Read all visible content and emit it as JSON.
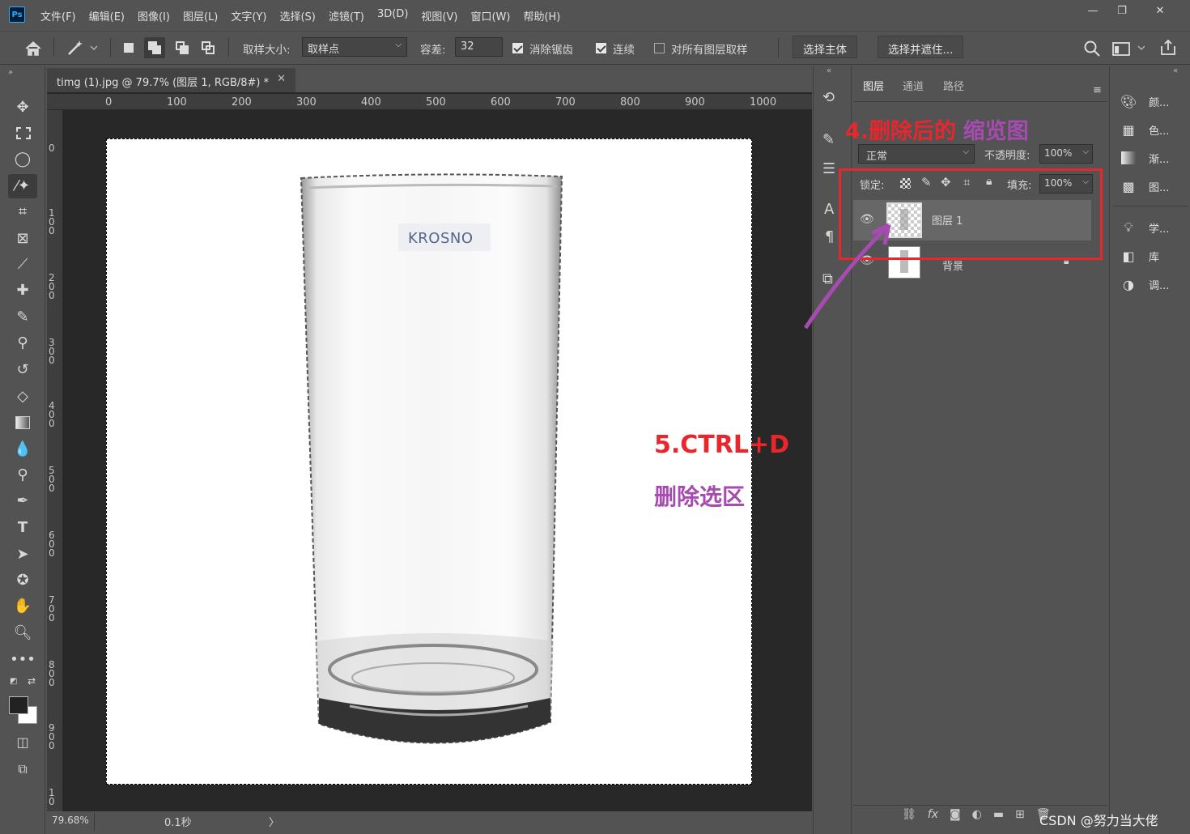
{
  "app": {
    "logo": "Ps"
  },
  "menu": [
    "文件(F)",
    "编辑(E)",
    "图像(I)",
    "图层(L)",
    "文字(Y)",
    "选择(S)",
    "滤镜(T)",
    "3D(D)",
    "视图(V)",
    "窗口(W)",
    "帮助(H)"
  ],
  "window_controls": {
    "minimize": "—",
    "restore": "❐",
    "close": "✕"
  },
  "options": {
    "sample_size_label": "取样大小:",
    "sample_size_value": "取样点",
    "tolerance_label": "容差:",
    "tolerance_value": "32",
    "antialias_label": "消除锯齿",
    "antialias_checked": true,
    "contiguous_label": "连续",
    "contiguous_checked": true,
    "sample_all_label": "对所有图层取样",
    "sample_all_checked": false,
    "select_subject": "选择主体",
    "select_mask": "选择并遮住..."
  },
  "document": {
    "tab_title": "timg (1).jpg @ 79.7% (图层 1, RGB/8#) *",
    "label_text": "KROSNO",
    "ruler_h": [
      "0",
      "100",
      "200",
      "300",
      "400",
      "500",
      "600",
      "700",
      "800",
      "900",
      "1000"
    ],
    "ruler_v": [
      [
        "0"
      ],
      [
        "1",
        "0",
        "0"
      ],
      [
        "2",
        "0",
        "0"
      ],
      [
        "3",
        "0",
        "0"
      ],
      [
        "4",
        "0",
        "0"
      ],
      [
        "5",
        "0",
        "0"
      ],
      [
        "6",
        "0",
        "0"
      ],
      [
        "7",
        "0",
        "0"
      ],
      [
        "8",
        "0",
        "0"
      ],
      [
        "9",
        "0",
        "0"
      ],
      [
        "1",
        "0"
      ]
    ]
  },
  "status": {
    "zoom": "79.68%",
    "timing": "0.1秒"
  },
  "layers_panel": {
    "tabs": [
      "图层",
      "通道",
      "路径"
    ],
    "blend_mode": "正常",
    "opacity_label": "不透明度:",
    "opacity_value": "100%",
    "lock_label": "锁定:",
    "fill_label": "填充:",
    "fill_value": "100%",
    "layers": [
      {
        "name": "图层 1",
        "selected": true
      },
      {
        "name": "背景",
        "selected": false
      }
    ]
  },
  "right_panel": [
    {
      "icon": "palette-icon",
      "label": "颜..."
    },
    {
      "icon": "swatches-icon",
      "label": "色..."
    },
    {
      "icon": "gradient-icon",
      "label": "渐..."
    },
    {
      "icon": "patterns-icon",
      "label": "图..."
    },
    {
      "icon": "learn-icon",
      "label": "学..."
    },
    {
      "icon": "library-icon",
      "label": "库"
    },
    {
      "icon": "adjustments-icon",
      "label": "调..."
    }
  ],
  "annotations": {
    "step4_red": "4.删除后的",
    "step4_purple": "缩览图",
    "step5_title": "5.CTRL+D",
    "step5_desc": "删除选区"
  },
  "watermark": "CSDN @努力当大佬",
  "colors": {
    "annotation_red": "#e8262b",
    "annotation_purple": "#a64bb0",
    "ps_blue": "#31a8ff"
  }
}
